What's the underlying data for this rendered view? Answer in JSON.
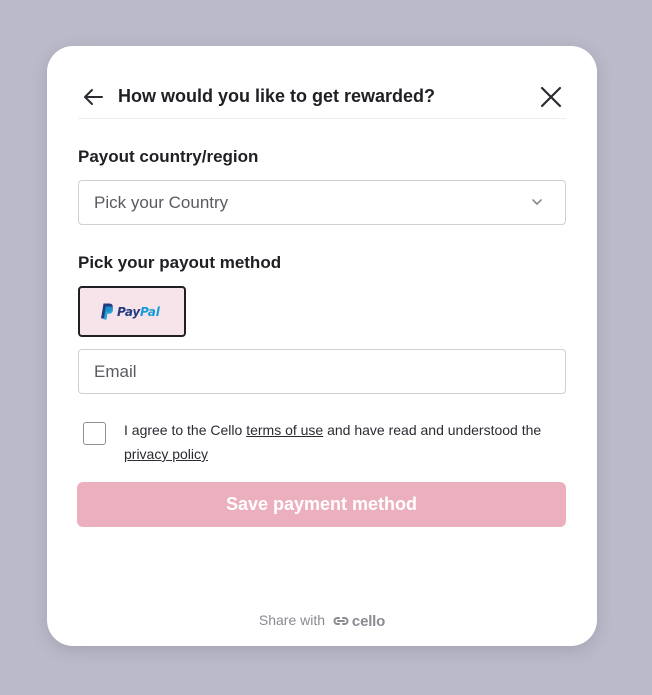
{
  "header": {
    "title": "How would you like to get rewarded?"
  },
  "country": {
    "label": "Payout country/region",
    "placeholder": "Pick your Country"
  },
  "payout": {
    "label": "Pick your payout method",
    "methods": [
      {
        "name_pay": "Pay",
        "name_pal": "Pal",
        "selected": true
      }
    ]
  },
  "email": {
    "placeholder": "Email",
    "value": ""
  },
  "terms": {
    "prefix": "I agree to the Cello",
    "terms_link": "terms of use",
    "middle": "and have read and understood the",
    "privacy_link": "privacy policy",
    "checked": false
  },
  "save_button": {
    "label": "Save payment method",
    "disabled": true
  },
  "footer": {
    "text": "Share with",
    "brand": "cello"
  },
  "colors": {
    "backdrop": "#babac9",
    "accent_disabled": "#ecafbd",
    "method_selected_bg": "#f7e4ea",
    "paypal_dark": "#253b80",
    "paypal_light": "#179bd7"
  },
  "icons": {
    "back": "arrow-left-icon",
    "close": "close-icon",
    "select": "chevron-down-icon",
    "brand": "cello-logo-icon"
  }
}
